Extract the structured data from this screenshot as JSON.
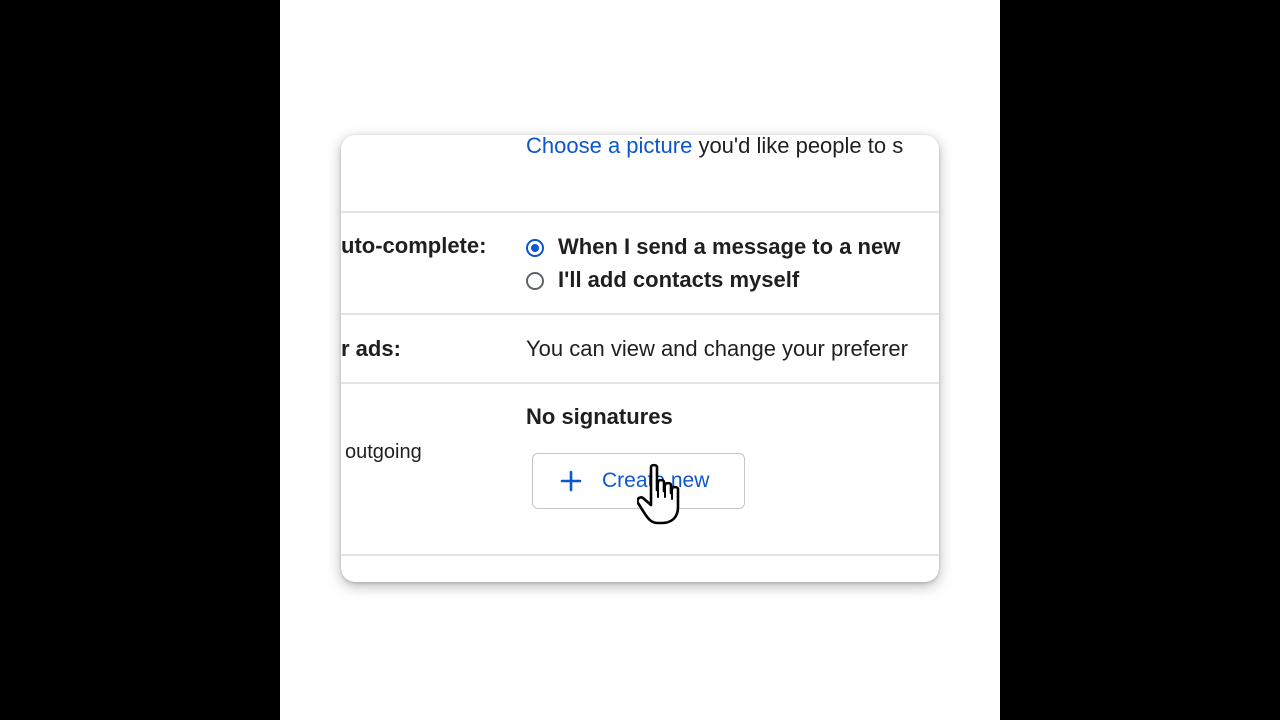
{
  "settings": {
    "picture": {
      "link": "Choose a picture",
      "text": " you'd like people to s"
    },
    "autocomplete": {
      "label": "uto-complete:",
      "options": [
        {
          "label": "When I send a message to a new",
          "selected": true
        },
        {
          "label": "I'll add contacts myself",
          "selected": false
        }
      ]
    },
    "ads": {
      "label": "r ads:",
      "text": "You can view and change your preferer"
    },
    "signature": {
      "label": "outgoing",
      "status": "No signatures",
      "create_label": "Create new"
    }
  },
  "colors": {
    "accent": "#0b57d0",
    "text": "#1f1f1f",
    "divider": "#e3e3e3"
  },
  "icons": {
    "plus": "plus-icon",
    "cursor": "hand-pointer-icon"
  }
}
